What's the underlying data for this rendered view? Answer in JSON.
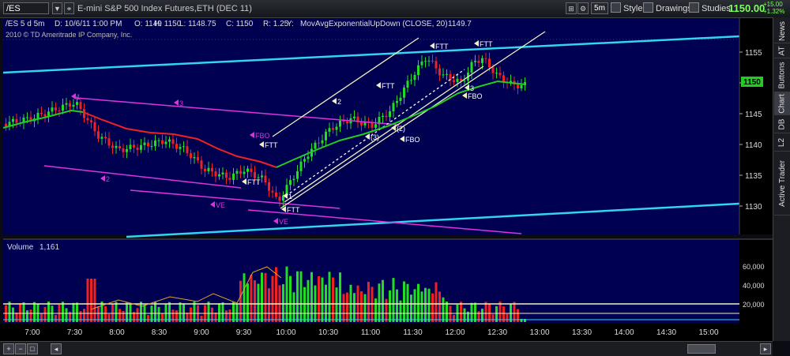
{
  "toolbar": {
    "symbol": "/ES",
    "description": "E-mini S&P 500 Index Futures,ETH (DEC 11)",
    "timeframe": "5m",
    "style_label": "Style",
    "drawings_label": "Drawings",
    "studies_label": "Studies",
    "last_price": "1150.00",
    "change_abs": "+15.00",
    "change_pct": "+1.32%"
  },
  "info_bar": {
    "symbol_period": "/ES 5 d 5m",
    "datetime": "D: 10/6/11 1:00 PM",
    "open": "O: 1149",
    "high": "H: 1150",
    "low": "L: 1148.75",
    "close": "C: 1150",
    "range": "R: 1.25",
    "y_label": "Y:",
    "study": "MovAvgExponentialUpDown (CLOSE, 20)",
    "study_value": "1149.7",
    "copyright": "2010 © TD Ameritrade IP Company, Inc."
  },
  "price_axis": {
    "ticks": [
      "1155",
      "1150",
      "1145",
      "1140",
      "1135",
      "1130"
    ],
    "current": "1150"
  },
  "volume_panel": {
    "title": "Volume",
    "value": "1,161",
    "ticks": [
      "60,000",
      "40,000",
      "20,000"
    ]
  },
  "time_axis": {
    "labels": [
      "7:00",
      "7:30",
      "8:00",
      "8:30",
      "9:00",
      "9:30",
      "10:00",
      "10:30",
      "11:00",
      "11:30",
      "12:00",
      "12:30",
      "13:00",
      "13:30",
      "14:00",
      "14:30",
      "15:00"
    ]
  },
  "annotations": {
    "magenta": [
      "1",
      "3",
      "2",
      "VE",
      "FBO",
      "VE"
    ],
    "white": [
      "FTT",
      "FTT",
      "FTT",
      "2",
      "FTT",
      "(2)",
      "FBO",
      "FBO",
      "(3)",
      "3",
      "FTT",
      "1",
      "FTT"
    ]
  },
  "right_tabs": [
    "News",
    "AT",
    "Buttons",
    "Chart",
    "DB",
    "L2",
    "Active Trader"
  ],
  "colors": {
    "background": "#000050",
    "up": "#22dd22",
    "down": "#ee2222",
    "channel": "#33d4f0",
    "magenta": "#dd33dd",
    "ema": "#22cc22",
    "ema_down": "#ee2222"
  },
  "chart_data": {
    "type": "line",
    "title": "/ES 5 d 5m",
    "ylim": [
      1127,
      1158
    ],
    "series": [
      {
        "name": "MovAvgExponentialUpDown (CLOSE, 20)",
        "values": []
      }
    ]
  }
}
